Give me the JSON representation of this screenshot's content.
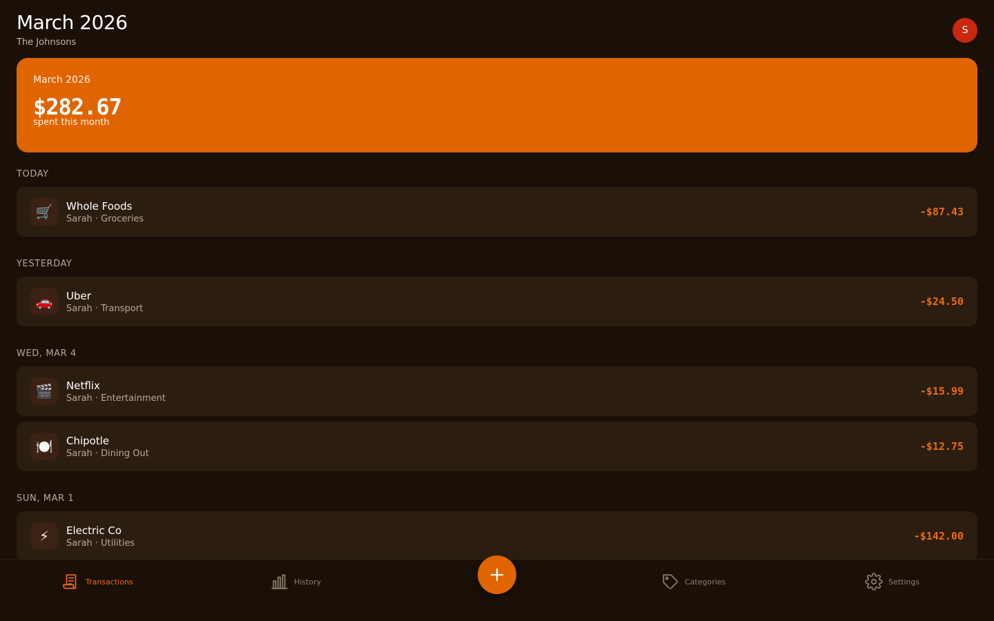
{
  "header": {
    "title": "March 2026",
    "household": "The Johnsons",
    "avatar_initial": "S"
  },
  "summary": {
    "month": "March 2026",
    "amount": "$282.67",
    "caption": "spent this month"
  },
  "groups": [
    {
      "label": "TODAY",
      "transactions": [
        {
          "icon": "🛒",
          "icon_name": "shopping-cart-icon",
          "name": "Whole Foods",
          "meta": "Sarah · Groceries",
          "amount": "-$87.43"
        }
      ]
    },
    {
      "label": "YESTERDAY",
      "transactions": [
        {
          "icon": "🚗",
          "icon_name": "car-icon",
          "name": "Uber",
          "meta": "Sarah · Transport",
          "amount": "-$24.50"
        }
      ]
    },
    {
      "label": "WED, MAR 4",
      "transactions": [
        {
          "icon": "🎬",
          "icon_name": "clapperboard-icon",
          "name": "Netflix",
          "meta": "Sarah · Entertainment",
          "amount": "-$15.99"
        },
        {
          "icon": "🍽️",
          "icon_name": "plate-utensils-icon",
          "name": "Chipotle",
          "meta": "Sarah · Dining Out",
          "amount": "-$12.75"
        }
      ]
    },
    {
      "label": "SUN, MAR 1",
      "transactions": [
        {
          "icon": "⚡",
          "icon_name": "lightning-icon",
          "name": "Electric Co",
          "meta": "Sarah · Utilities",
          "amount": "-$142.00"
        }
      ]
    }
  ],
  "nav": {
    "transactions": "Transactions",
    "history": "History",
    "categories": "Categories",
    "settings": "Settings",
    "active": "transactions"
  },
  "colors": {
    "accent": "#e06400",
    "amount": "#ef6a10",
    "background": "#1a1008",
    "card": "#2b1e11",
    "avatar": "#c8280f"
  }
}
